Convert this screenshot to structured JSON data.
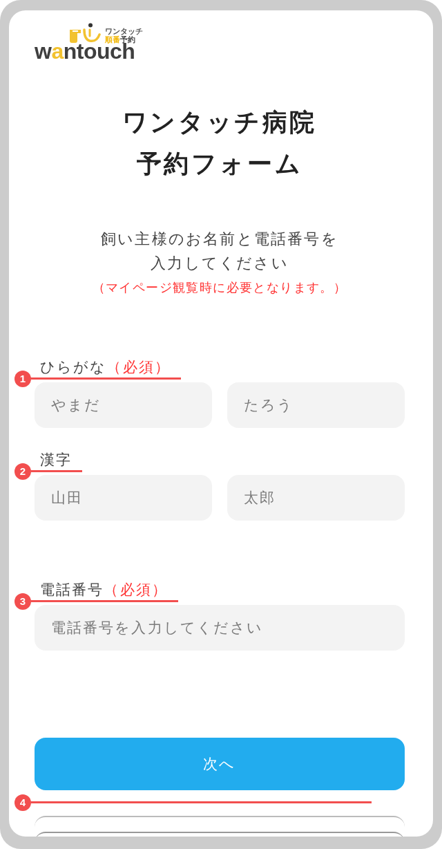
{
  "logo": {
    "tagline": [
      {
        "parts": [
          {
            "text": "ワンタッチ",
            "color": "#555555"
          }
        ]
      },
      {
        "parts": [
          {
            "text": "順番",
            "color": "#f2b705"
          },
          {
            "text": "予約",
            "color": "#444444"
          }
        ]
      }
    ],
    "wordmark": [
      {
        "text": "w",
        "color": "#3f3f3f"
      },
      {
        "text": "a",
        "color": "#f2c230"
      },
      {
        "text": "ntouch",
        "color": "#3f3f3f"
      }
    ]
  },
  "title": [
    "ワンタッチ病院",
    "予約フォーム"
  ],
  "intro": [
    "飼い主様のお名前と電話番号を",
    "入力してください"
  ],
  "note": "（マイページ観覧時に必要となります。）",
  "fields": [
    {
      "label": "ひらがな",
      "required_mark": "（必須）",
      "annotation": "1",
      "inputs": [
        {
          "placeholder": "やまだ"
        },
        {
          "placeholder": "たろう"
        }
      ]
    },
    {
      "label": "漢字",
      "annotation": "2",
      "inputs": [
        {
          "placeholder": "山田"
        },
        {
          "placeholder": "太郎"
        }
      ]
    },
    {
      "label": "電話番号",
      "required_mark": "（必須）",
      "annotation": "3",
      "inputs": [
        {
          "placeholder": "電話番号を入力してください"
        }
      ]
    }
  ],
  "next_button": {
    "label": "次へ",
    "annotation": "4"
  }
}
